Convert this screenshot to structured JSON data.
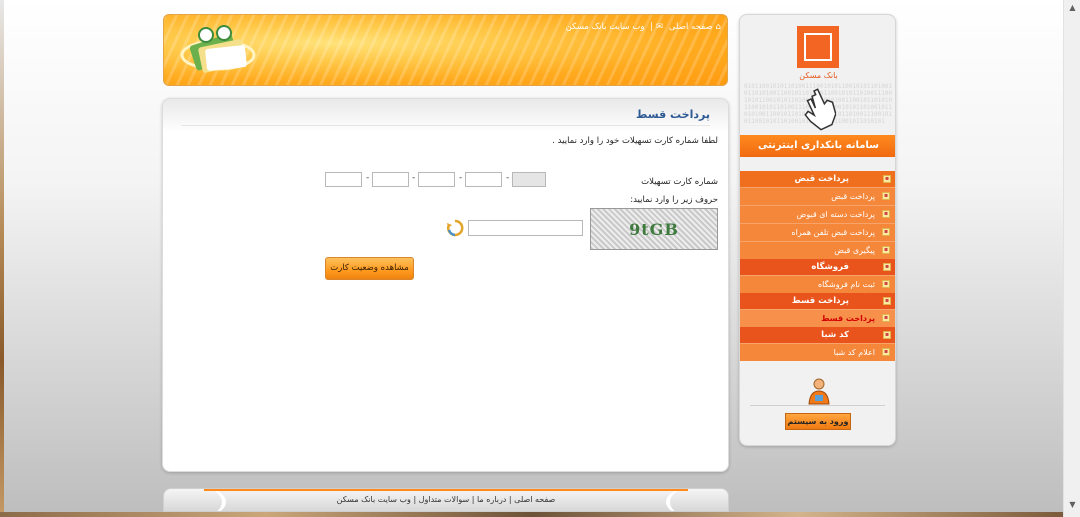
{
  "header": {
    "links": [
      "صفحه اصلی",
      "وب سایت بانک مسکن"
    ]
  },
  "content": {
    "title": "پرداخت قسط",
    "instruction": "لطفا شماره کارت تسهیلات خود را وارد نمایید .",
    "card_label": "شماره کارت تسهیلات",
    "card_separator": "-",
    "captcha_label": "حروف زیر را وارد نمایید:",
    "captcha_text": "9tGB",
    "submit_label": "مشاهده وضعیت کارت"
  },
  "footer": {
    "links": "صفحه اصلی | درباره ما | سوالات متداول | وب سایت بانک مسکن"
  },
  "sidebar": {
    "logo_text": "بانک مسکن",
    "system_title": "سامانه بانکداری اینترنتی",
    "binary": "0101100101011010011100101011001010110100101101010011001011010101100101011010011100101011001010110100101101010011001011010101100101011010011100101011001010110100101101010011001011010101100101011010011100101011001010110100101101010011001011010101",
    "menu": [
      {
        "title": "پرداخت قبض",
        "items": [
          "پرداخت قبض",
          "پرداخت دسته ای قبوض",
          "پرداخت قبض تلفن همراه",
          "پیگیری قبض"
        ]
      },
      {
        "title": "فروشگاه",
        "items": [
          "ثبت نام فروشگاه"
        ]
      },
      {
        "title": "پرداخت قسط",
        "items": [
          "پرداخت قسط"
        ]
      },
      {
        "title": "کد شبا",
        "items": [
          "اعلام کد شبا"
        ]
      }
    ],
    "login_label": "ورود به سیستم"
  },
  "colors": {
    "accent_orange": "#f26522",
    "title_blue": "#2d5a94",
    "active_red": "#d20000"
  }
}
